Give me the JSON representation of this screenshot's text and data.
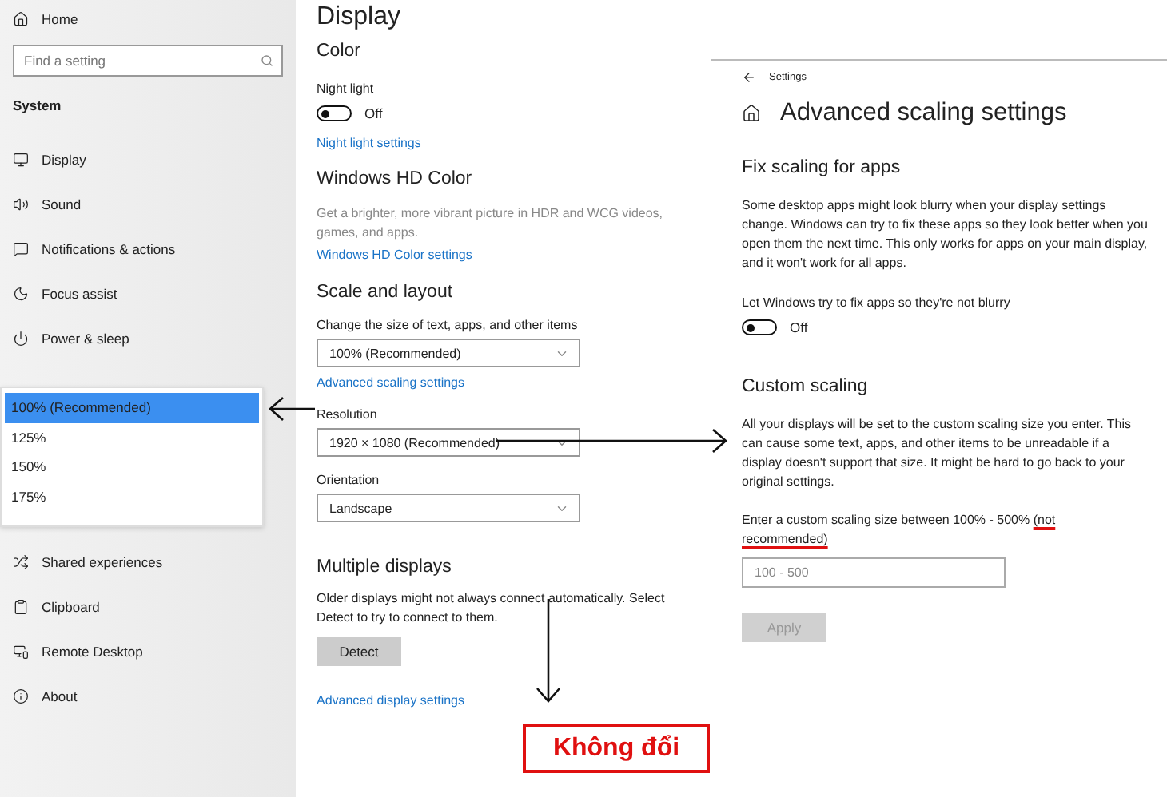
{
  "sidebar": {
    "home": "Home",
    "search": {
      "placeholder": "Find a setting"
    },
    "section": "System",
    "items_top": [
      {
        "label": "Display"
      },
      {
        "label": "Sound"
      },
      {
        "label": "Notifications & actions"
      },
      {
        "label": "Focus assist"
      },
      {
        "label": "Power & sleep"
      }
    ],
    "scale_list": [
      {
        "label": "100% (Recommended)",
        "selected": true
      },
      {
        "label": "125%",
        "selected": false
      },
      {
        "label": "150%",
        "selected": false
      },
      {
        "label": "175%",
        "selected": false
      }
    ],
    "items_bottom": [
      {
        "label": "Shared experiences"
      },
      {
        "label": "Clipboard"
      },
      {
        "label": "Remote Desktop"
      },
      {
        "label": "About"
      }
    ]
  },
  "display": {
    "title": "Display",
    "color_heading": "Color",
    "night_light": {
      "label": "Night light",
      "toggle": {
        "on": false,
        "text": "Off"
      },
      "link": "Night light settings"
    },
    "hd_heading": "Windows HD Color",
    "hd_description": "Get a brighter, more vibrant picture in HDR and WCG videos, games, and apps.",
    "hd_link": "Windows HD Color settings",
    "scale_heading": "Scale and layout",
    "scale_label": "Change the size of text, apps, and other items",
    "scale_value": "100% (Recommended)",
    "scale_link": "Advanced scaling settings",
    "resolution_label": "Resolution",
    "resolution_value": "1920 × 1080 (Recommended)",
    "orientation_label": "Orientation",
    "orientation_value": "Landscape",
    "multi_heading": "Multiple displays",
    "multi_description": "Older displays might not always connect automatically. Select Detect to try to connect to them.",
    "detect_button": "Detect",
    "advanced_link": "Advanced display settings"
  },
  "advanced": {
    "back_title": "Settings",
    "title": "Advanced scaling settings",
    "fix_heading": "Fix scaling for apps",
    "fix_description": "Some desktop apps might look blurry when your display settings change. Windows can try to fix these apps so they look better when you open them the next time. This only works for apps on your main display, and it won't work for all apps.",
    "fix_label": "Let Windows try to fix apps so they're not blurry",
    "fix_toggle": {
      "on": false,
      "text": "Off"
    },
    "custom_heading": "Custom scaling",
    "custom_description": "All your displays will be set to the custom scaling size you enter. This can cause some text, apps, and other items to be unreadable if a display doesn't support that size. It might be hard to go back to your original settings.",
    "custom_prompt": "Enter a custom scaling size between 100% - 500%",
    "custom_prompt_underlined": "(not recommended)",
    "custom_input": {
      "placeholder": "100 - 500"
    },
    "apply_button": {
      "label": "Apply",
      "disabled": true
    }
  },
  "annotation": {
    "label": "Không đổi"
  }
}
